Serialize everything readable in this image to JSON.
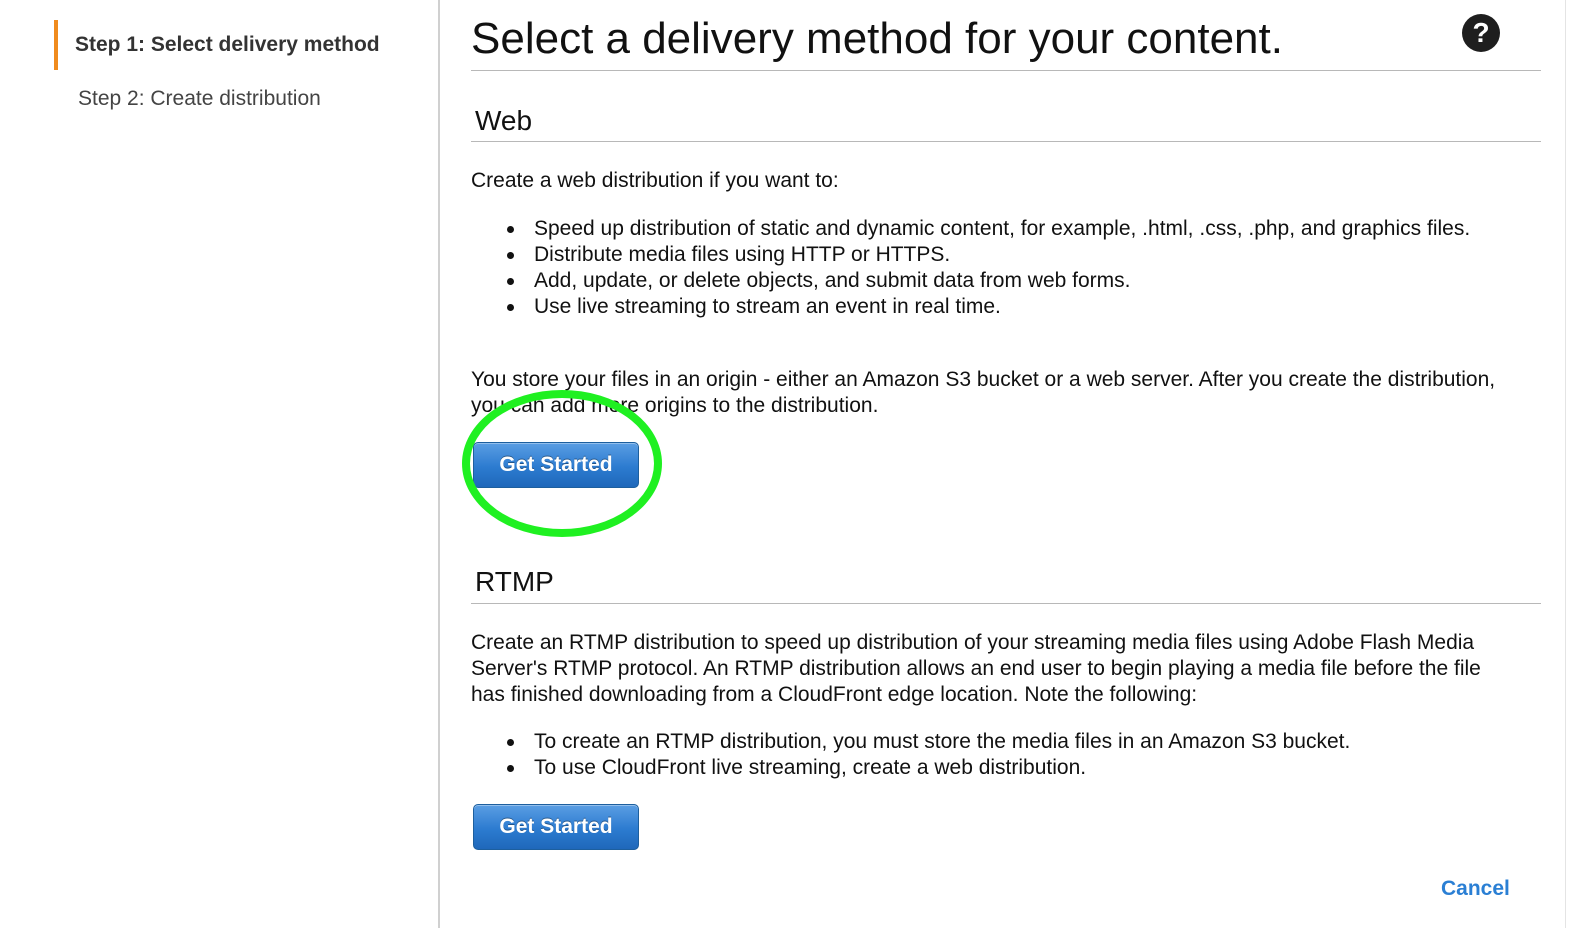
{
  "sidebar": {
    "steps": [
      {
        "label": "Step 1: Select delivery method"
      },
      {
        "label": "Step 2: Create distribution"
      }
    ]
  },
  "header": {
    "title": "Select a delivery method for your content.",
    "help_icon": "question-circle-icon"
  },
  "web": {
    "title": "Web",
    "intro": "Create a web distribution if you want to:",
    "bullets": [
      "Speed up distribution of static and dynamic content, for example, .html, .css, .php, and graphics files.",
      "Distribute media files using HTTP or HTTPS.",
      "Add, update, or delete objects, and submit data from web forms.",
      "Use live streaming to stream an event in real time."
    ],
    "note": "You store your files in an origin - either an Amazon S3 bucket or a web server. After you create the distribution, you can add more origins to the distribution.",
    "button_label": "Get Started"
  },
  "rtmp": {
    "title": "RTMP",
    "intro": "Create an RTMP distribution to speed up distribution of your streaming media files using Adobe Flash Media Server's RTMP protocol. An RTMP distribution allows an end user to begin playing a media file before the file has finished downloading from a CloudFront edge location. Note the following:",
    "bullets": [
      "To create an RTMP distribution, you must store the media files in an Amazon S3 bucket.",
      "To use CloudFront live streaming, create a web distribution."
    ],
    "button_label": "Get Started"
  },
  "footer": {
    "cancel_label": "Cancel"
  },
  "colors": {
    "accent_orange": "#f08b1d",
    "button_blue": "#2c7bd0",
    "link_blue": "#2a7fd4",
    "highlight_green": "#1ff021"
  }
}
